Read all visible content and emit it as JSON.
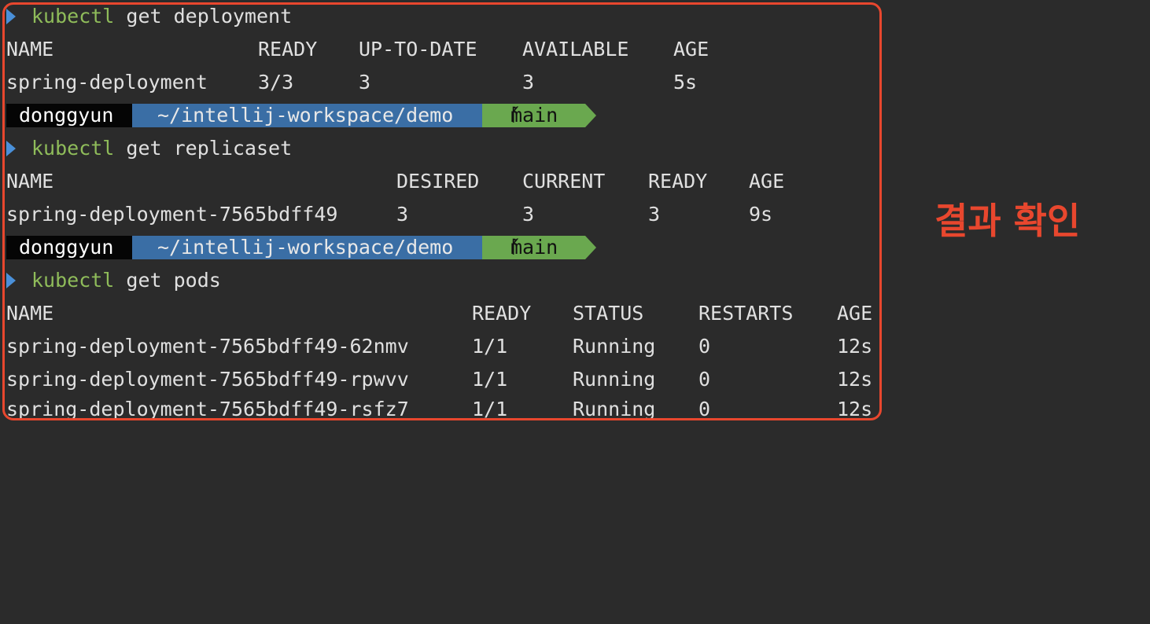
{
  "colors": {
    "background": "#2b2b2b",
    "command_keyword": "#8fbc5a",
    "prompt_arrow": "#4a90d9",
    "powerline_user": "#050505",
    "powerline_path": "#3a6ea5",
    "powerline_git": "#6aa84f",
    "annotation": "#e8472e"
  },
  "commands": [
    {
      "keyword": "kubectl",
      "args": " get deployment"
    },
    {
      "keyword": "kubectl",
      "args": " get replicaset"
    },
    {
      "keyword": "kubectl",
      "args": " get pods"
    }
  ],
  "deployment": {
    "headers": [
      "NAME",
      "READY",
      "UP-TO-DATE",
      "AVAILABLE",
      "AGE"
    ],
    "rows": [
      [
        "spring-deployment",
        "3/3",
        "3",
        "3",
        "5s"
      ]
    ]
  },
  "replicaset": {
    "headers": [
      "NAME",
      "DESIRED",
      "CURRENT",
      "READY",
      "AGE"
    ],
    "rows": [
      [
        "spring-deployment-7565bdff49",
        "3",
        "3",
        "3",
        "9s"
      ]
    ]
  },
  "pods": {
    "headers": [
      "NAME",
      "READY",
      "STATUS",
      "RESTARTS",
      "AGE"
    ],
    "rows": [
      [
        "spring-deployment-7565bdff49-62nmv",
        "1/1",
        "Running",
        "0",
        "12s"
      ],
      [
        "spring-deployment-7565bdff49-rpwvv",
        "1/1",
        "Running",
        "0",
        "12s"
      ],
      [
        "spring-deployment-7565bdff49-rsfz7",
        "1/1",
        "Running",
        "0",
        "12s"
      ]
    ]
  },
  "prompt": {
    "user": "donggyun",
    "path": "~/intellij-workspace/demo",
    "branch_icon": "git-branch-icon",
    "branch": "main"
  },
  "annotation": "결과 확인"
}
